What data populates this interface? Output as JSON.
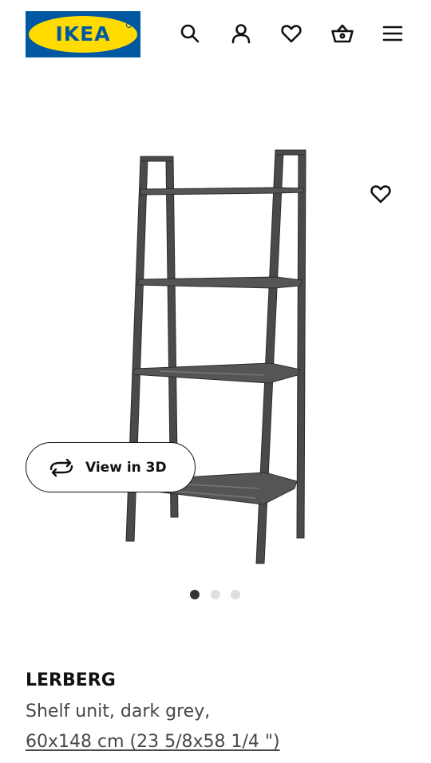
{
  "brand": {
    "logo_text": "IKEA",
    "colors": {
      "blue": "#0058a3",
      "yellow": "#ffdb00"
    }
  },
  "header": {
    "icons": [
      {
        "name": "search-icon"
      },
      {
        "name": "user-icon"
      },
      {
        "name": "heart-icon"
      },
      {
        "name": "shopping-basket-icon"
      },
      {
        "name": "menu-icon"
      }
    ]
  },
  "gallery": {
    "image": "shelf-unit-image",
    "favorite_icon": "heart-icon",
    "view_3d_label": "View in 3D",
    "view_3d_icon": "rotate-3d-icon",
    "slides": 3,
    "active_slide": 1
  },
  "product": {
    "name": "LERBERG",
    "description": "Shelf unit, dark grey,",
    "size": "60x148 cm (23 5/8x58 1/4 \")"
  }
}
